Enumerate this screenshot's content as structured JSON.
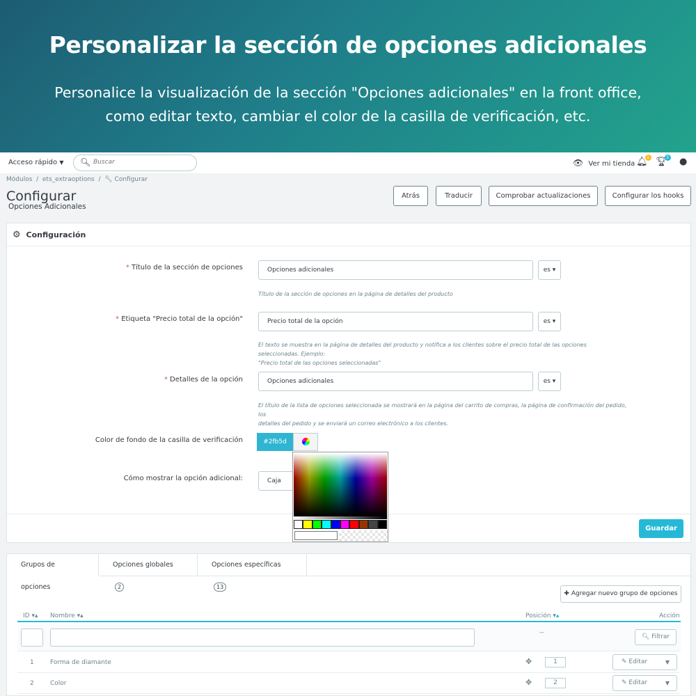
{
  "banner": {
    "title": "Personalizar la sección de opciones adicionales",
    "line1": "Personalice la visualización de la sección \"Opciones adicionales\" en la front office,",
    "line2": "como editar texto, cambiar el color de la casilla de verificación, etc."
  },
  "header": {
    "quick_access": "Acceso rápido",
    "search_placeholder": "Buscar",
    "store_link": "Ver mi tienda",
    "notif_orders": "1",
    "notif_trophy": "3"
  },
  "breadcrumb": [
    "Módulos",
    "ets_extraoptions",
    "Configurar"
  ],
  "page": {
    "title": "Configurar",
    "subtitle": "Opciones Adicionales",
    "buttons": [
      "Atrás",
      "Traducir",
      "Comprobar actualizaciones",
      "Configurar los hooks"
    ]
  },
  "panel": {
    "title": "Configuración",
    "fields": {
      "section_title": {
        "label": "Título de la sección de opciones",
        "value": "Opciones adicionales",
        "lang": "es",
        "help": "Título de la sección de opciones en la página de detalles del producto"
      },
      "total_label": {
        "label": "Etiqueta \"Precio total de la opción\"",
        "value": "Precio total de la opción",
        "lang": "es",
        "help1": "El texto se muestra en la página de detalles del producto y notifica a los clientes sobre el precio total de las opciones seleccionadas. Ejemplo:",
        "help2": "\"Precio total de las opciones seleccionadas\""
      },
      "details": {
        "label": "Detalles de la opción",
        "value": "Opciones adicionales",
        "lang": "es",
        "help1": "El título de la lista de opciones seleccionada se mostrará en la página del carrito de compras, la página de confirmación del pedido, los",
        "help2": "detalles del pedido y se enviará un correo electrónico a los clientes."
      },
      "bg_color": {
        "label": "Color de fondo de la casilla de verificación",
        "value": "#2fb5d"
      },
      "display": {
        "label": "Cómo mostrar la opción adicional:",
        "value": "Caja"
      }
    },
    "save": "Guardar"
  },
  "picker": {
    "swatches": [
      "#ffffff",
      "#ffff00",
      "#00ff00",
      "#00ffff",
      "#0000ff",
      "#ff00ff",
      "#ff0000",
      "#993300",
      "#444444",
      "#000000"
    ]
  },
  "tabs": {
    "items": [
      {
        "label": "Grupos de opciones",
        "badge": ""
      },
      {
        "label": "Opciones globales",
        "badge": "2"
      },
      {
        "label": "Opciones específicas",
        "badge": "13"
      }
    ],
    "add_group": "Agregar nuevo grupo de opciones"
  },
  "table": {
    "headers": {
      "id": "ID",
      "name": "Nombre",
      "position": "Posición",
      "action": "Acción"
    },
    "filter_placeholder": "--",
    "filter_button": "Filtrar",
    "rows": [
      {
        "id": "1",
        "name": "Forma de diamante",
        "position": "1",
        "action": "Editar"
      },
      {
        "id": "2",
        "name": "Color",
        "position": "2",
        "action": "Editar"
      }
    ]
  },
  "colors": {
    "accent": "#25b9d7",
    "checkbox_color": "#2fb5d2",
    "required": "#c05c67"
  }
}
